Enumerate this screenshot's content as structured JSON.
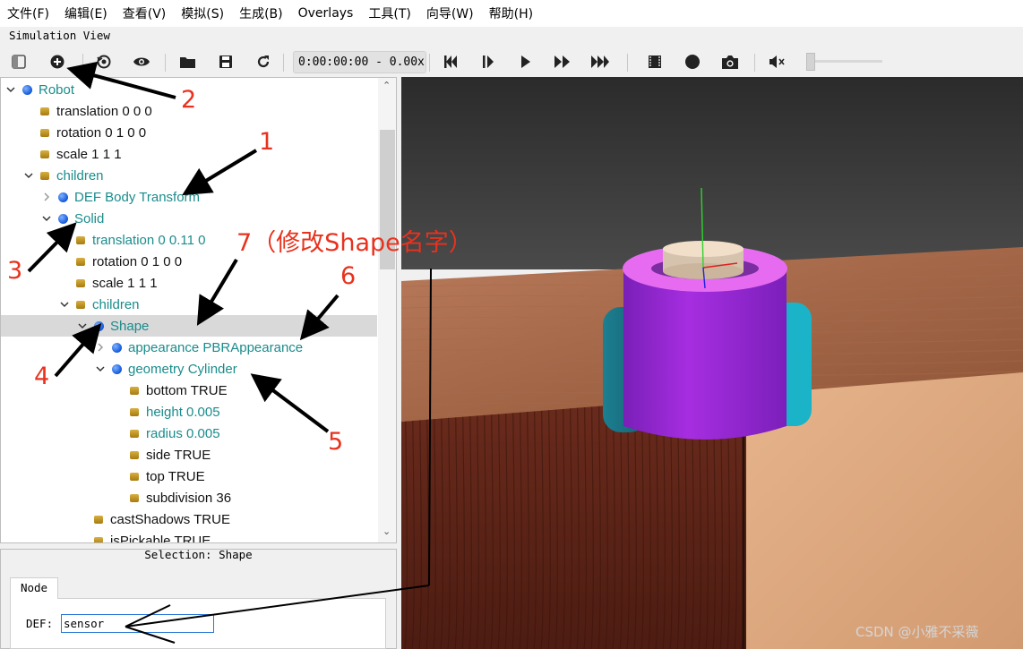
{
  "menubar": [
    "文件(F)",
    "编辑(E)",
    "查看(V)",
    "模拟(S)",
    "生成(B)",
    "Overlays",
    "工具(T)",
    "向导(W)",
    "帮助(H)"
  ],
  "sim_view_title": "Simulation View",
  "toolbar": {
    "time": "0:00:00:00 -  0.00x",
    "icons": [
      "toggle-panel-icon",
      "add-node-icon",
      "view-reset-icon",
      "eye-icon",
      "open-folder-icon",
      "save-icon",
      "reload-icon",
      "step-back-icon",
      "step-icon",
      "play-icon",
      "fast-forward-icon",
      "fastest-icon",
      "record-movie-icon",
      "record-icon",
      "screenshot-icon",
      "mute-icon"
    ],
    "volume": 0
  },
  "tree": {
    "rows": [
      {
        "text": "Robot",
        "kind": "node",
        "color": "teal"
      },
      {
        "text": "translation 0 0 0",
        "kind": "field",
        "color": "black"
      },
      {
        "text": "rotation 0 1 0 0",
        "kind": "field",
        "color": "black"
      },
      {
        "text": "scale 1 1 1",
        "kind": "field",
        "color": "black"
      },
      {
        "text": "children",
        "kind": "field",
        "color": "teal"
      },
      {
        "text": "DEF Body Transform",
        "kind": "node",
        "color": "teal"
      },
      {
        "text": "Solid",
        "kind": "node",
        "color": "teal"
      },
      {
        "text": "translation 0 0.11 0",
        "kind": "field",
        "color": "teal"
      },
      {
        "text": "rotation 0 1 0 0",
        "kind": "field",
        "color": "black"
      },
      {
        "text": "scale 1 1 1",
        "kind": "field",
        "color": "black"
      },
      {
        "text": "children",
        "kind": "field",
        "color": "teal"
      },
      {
        "text": "Shape",
        "kind": "node",
        "color": "teal"
      },
      {
        "text": "appearance PBRAppearance",
        "kind": "node",
        "color": "teal"
      },
      {
        "text": "geometry Cylinder",
        "kind": "node",
        "color": "teal"
      },
      {
        "text": "bottom TRUE",
        "kind": "field",
        "color": "black"
      },
      {
        "text": "height 0.005",
        "kind": "field",
        "color": "teal"
      },
      {
        "text": "radius 0.005",
        "kind": "field",
        "color": "teal"
      },
      {
        "text": "side TRUE",
        "kind": "field",
        "color": "black"
      },
      {
        "text": "top TRUE",
        "kind": "field",
        "color": "black"
      },
      {
        "text": "subdivision 36",
        "kind": "field",
        "color": "black"
      },
      {
        "text": "castShadows TRUE",
        "kind": "field",
        "color": "black"
      },
      {
        "text": "isPickable TRUE",
        "kind": "field",
        "color": "black"
      }
    ]
  },
  "selection_label": "Selection: Shape",
  "editor": {
    "tab": "Node",
    "def_label": "DEF:",
    "def_value": "sensor"
  },
  "annotations": {
    "n1": "1",
    "n2": "2",
    "n3": "3",
    "n4": "4",
    "n5": "5",
    "n6": "6",
    "n7": "7",
    "title7": "（修改Shape名字）"
  },
  "watermark": "CSDN @小雅不采薇",
  "colors": {
    "teal": "#1b8c8c",
    "annotation": "#e8321e",
    "robot_body": "#a026d6",
    "wheel": "#1f8fa0"
  }
}
